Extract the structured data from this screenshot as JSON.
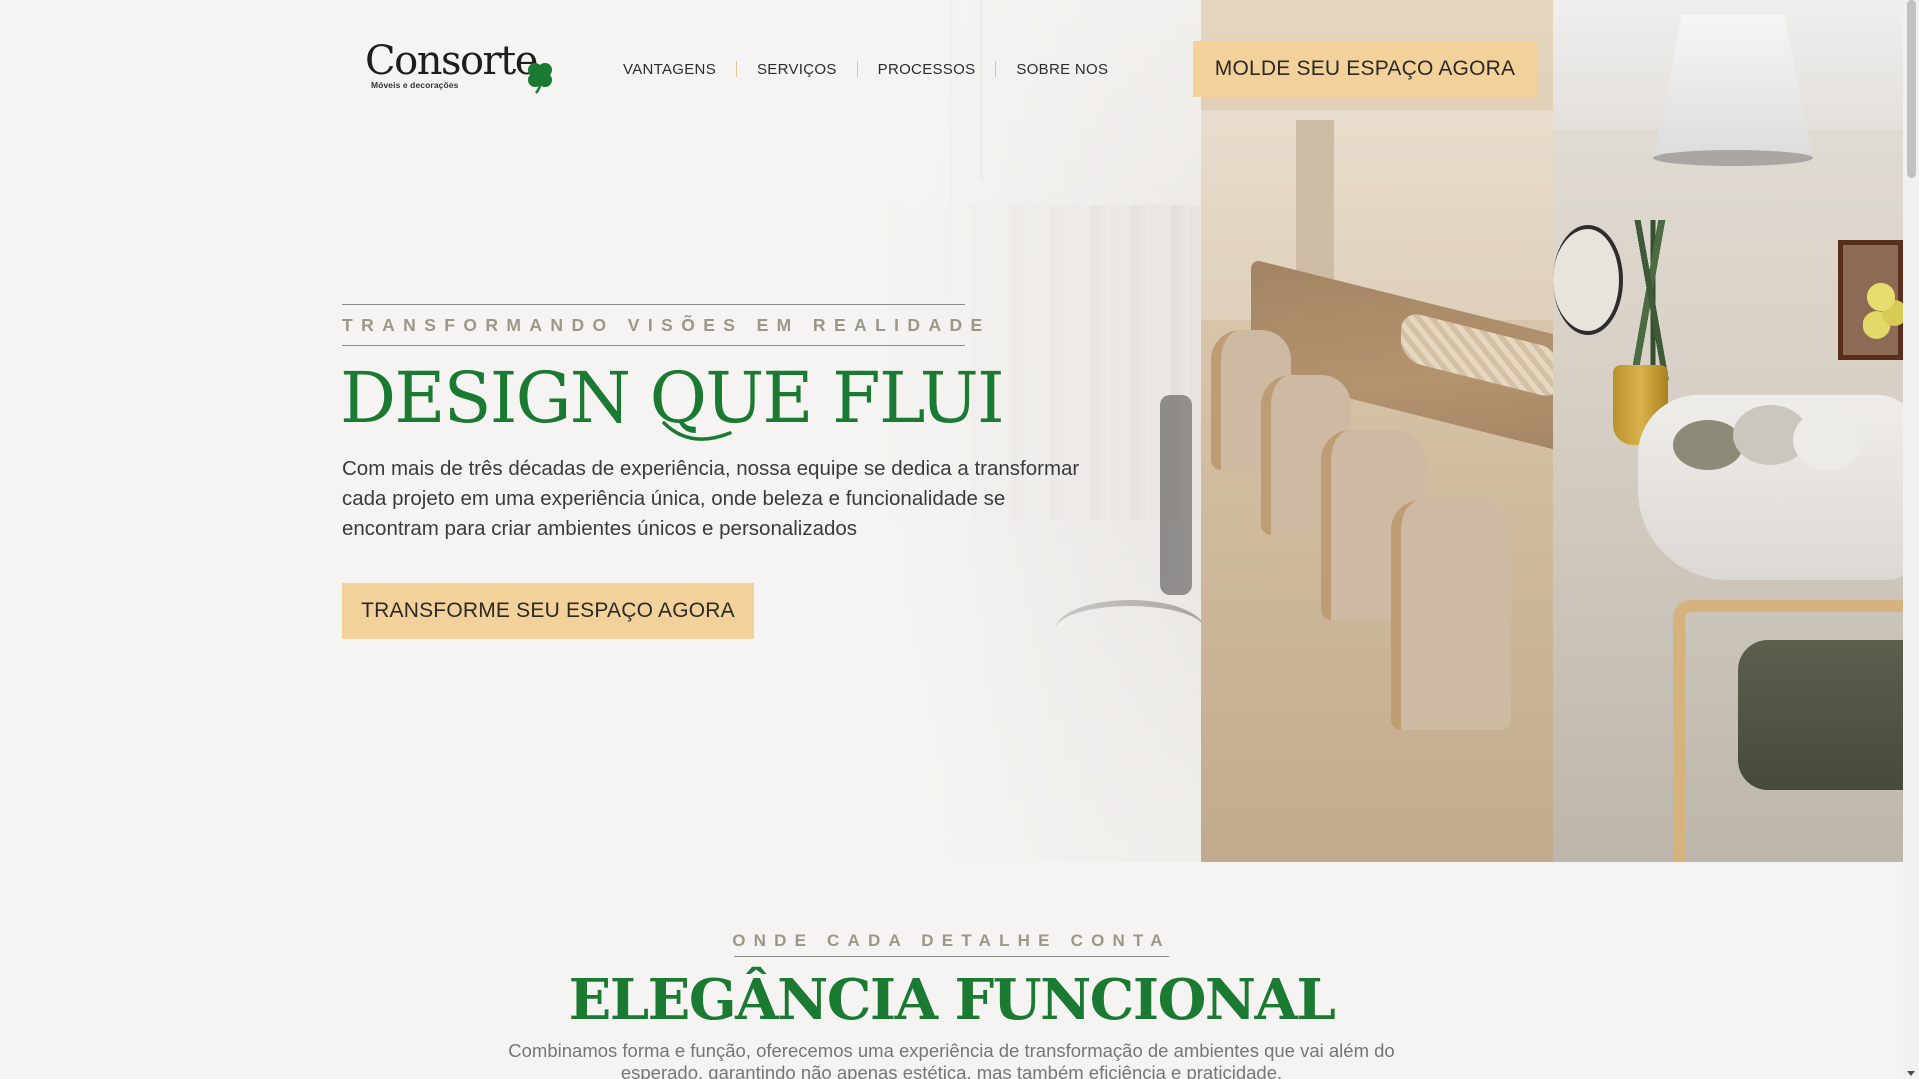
{
  "brand": {
    "name": "Consorte",
    "tagline": "Móveis e decorações",
    "accent_green": "#1b7a32",
    "accent_gold": "#f2d29a"
  },
  "nav": {
    "items": [
      "VANTAGENS",
      "SERVIÇOS",
      "PROCESSOS",
      "SOBRE NOS"
    ]
  },
  "header": {
    "cta_label": "MOLDE SEU ESPAÇO AGORA"
  },
  "hero": {
    "eyebrow": "TRANSFORMANDO VISÕES EM REALIDADE",
    "title": "DESIGN QUE FLUI",
    "paragraph": "Com mais de três décadas de experiência, nossa equipe se dedica a transformar cada projeto em uma experiência única, onde beleza e funcionalidade se encontram para criar ambientes únicos e personalizados",
    "cta_label": "TRANSFORME SEU ESPAÇO AGORA"
  },
  "section2": {
    "eyebrow": "ONDE CADA DETALHE CONTA",
    "title": "ELEGÂNCIA FUNCIONAL",
    "paragraph": "Combinamos forma e função, oferecemos uma experiência de transformação de ambientes que vai além do esperado, garantindo não apenas estética, mas também eficiência e praticidade."
  },
  "icons": {
    "logo_mark": "four-leaf-clover-icon",
    "scroll_down": "chevron-down-icon"
  }
}
